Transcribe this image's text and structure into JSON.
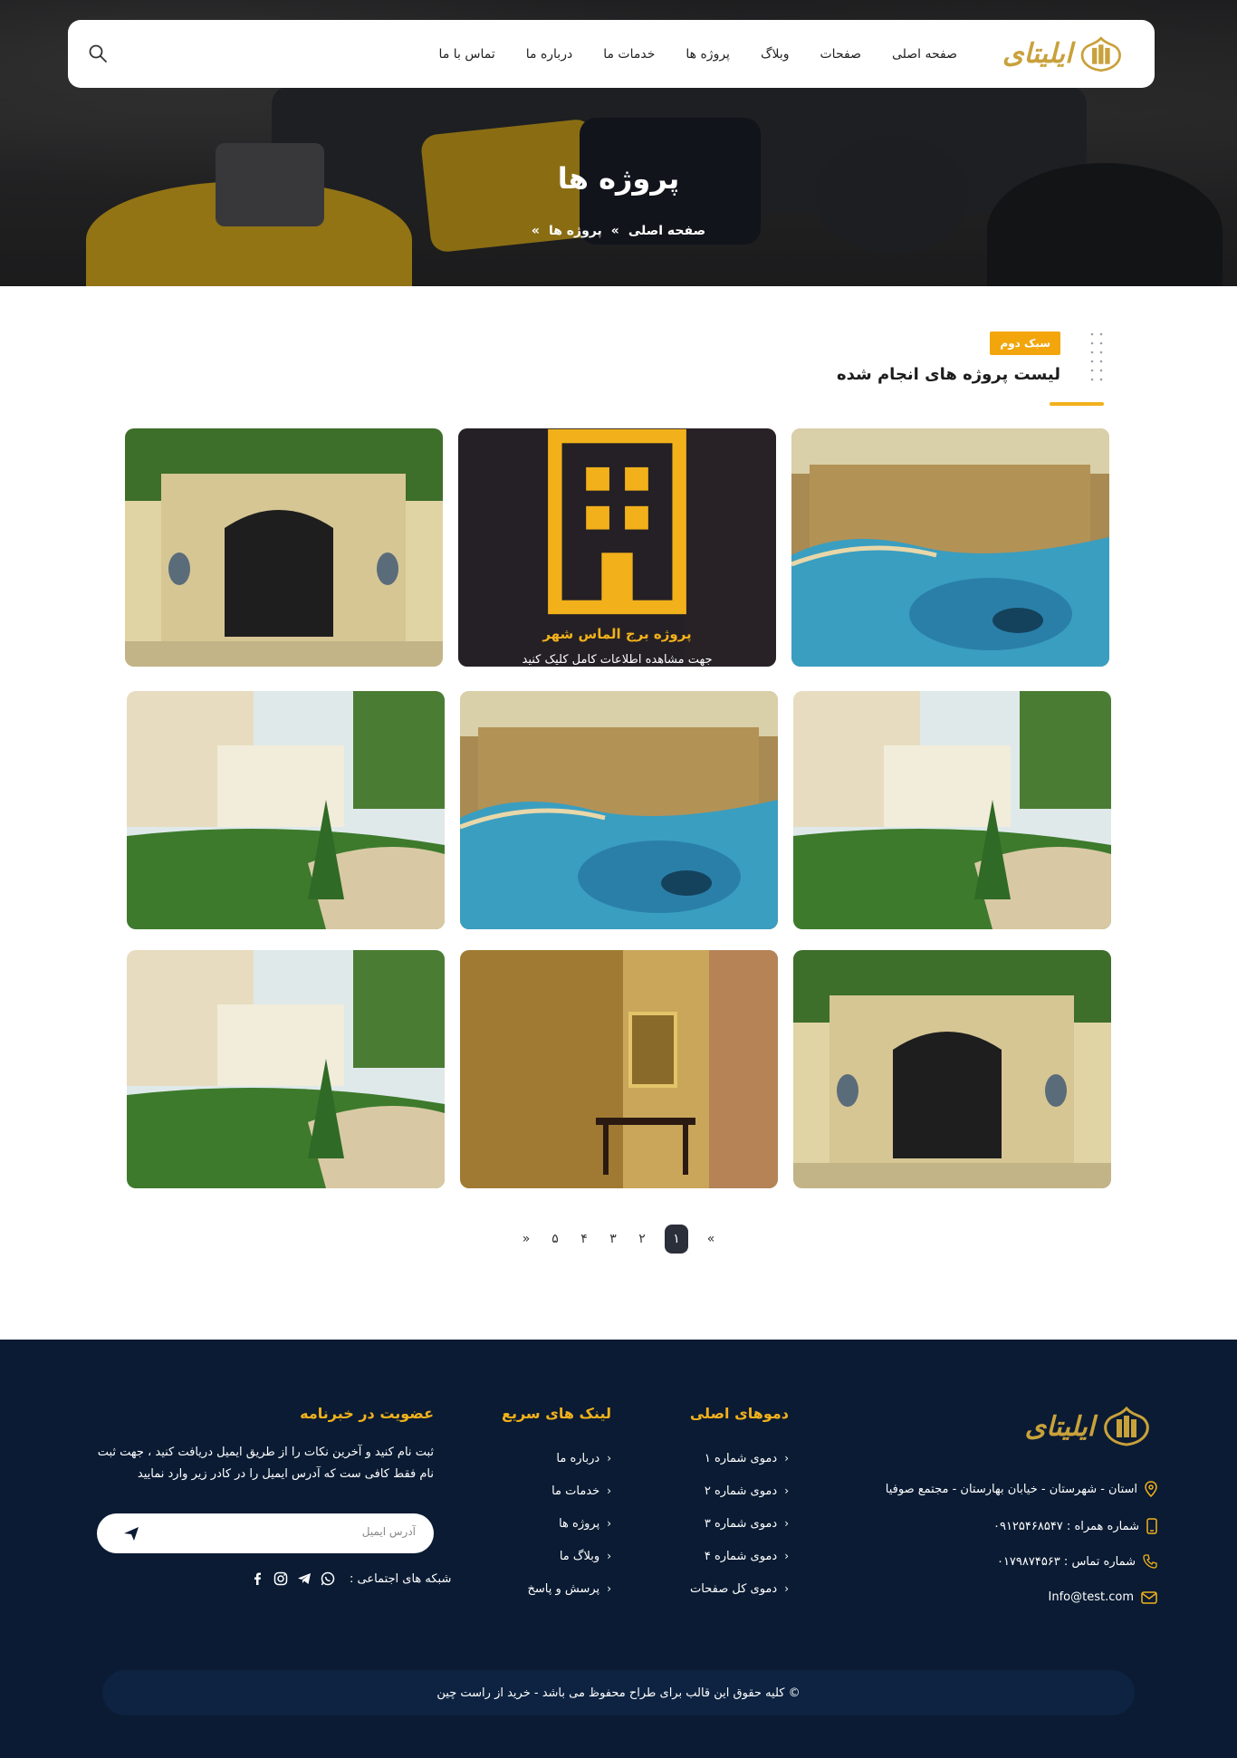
{
  "brand": {
    "logo_text": "ایلیتای",
    "accent": "#f2b11b",
    "footer_bg": "#0a1b33"
  },
  "nav": {
    "items": [
      {
        "label": "صفحه اصلی"
      },
      {
        "label": "صفحات"
      },
      {
        "label": "وبلاگ"
      },
      {
        "label": "پروژه ها"
      },
      {
        "label": "خدمات ما"
      },
      {
        "label": "درباره ما"
      },
      {
        "label": "تماس با ما"
      }
    ],
    "search_icon": "search-icon"
  },
  "hero": {
    "title": "پروژه ها",
    "breadcrumb": [
      "صفحه اصلی",
      "»",
      "پروژه ها",
      "»"
    ]
  },
  "section": {
    "badge": "سبک دوم",
    "title": "لیست پروژه های انجام شده"
  },
  "projects": {
    "hover_card": {
      "icon": "building-icon",
      "title": "پروژه برج الماس شهر",
      "subtitle": "جهت مشاهده اطلاعات کامل کلیک کنید"
    },
    "images": [
      "pool",
      "hover",
      "gate",
      "garden",
      "pool",
      "garden",
      "gate",
      "corridor",
      "garden"
    ]
  },
  "pagination": {
    "items": [
      "«",
      "۱",
      "۲",
      "۳",
      "۴",
      "۵",
      "»"
    ],
    "active": "۱"
  },
  "footer": {
    "logo_text": "ایلیتای",
    "contact": {
      "address": "استان - شهرستان - خیابان بهارستان - مجتمع صوفیا",
      "mobile": "شماره همراه : ۰۹۱۲۵۴۶۸۵۴۷",
      "phone": "شماره تماس : ۰۱۷۹۸۷۴۵۶۳",
      "email": "Info@test.com"
    },
    "demos": {
      "heading": "دموهای اصلی",
      "items": [
        "دموی شماره ۱",
        "دموی شماره ۲",
        "دموی شماره ۳",
        "دموی شماره ۴",
        "دموی کل صفحات"
      ]
    },
    "quick_links": {
      "heading": "لینک های سریع",
      "items": [
        "درباره ما",
        "خدمات ما",
        "پروژه ها",
        "وبلاگ ما",
        "پرسش و پاسخ"
      ]
    },
    "newsletter": {
      "heading": "عضویت در خبرنامه",
      "text": "ثبت نام کنید و آخرین نکات را از طریق ایمیل دریافت کنید ، جهت ثبت نام فقط کافی ست که آدرس ایمیل را در کادر زیر وارد نمایید",
      "placeholder": "آدرس ایمیل",
      "social_label": "شبکه های اجتماعی :",
      "social_icons": [
        "whatsapp-icon",
        "telegram-icon",
        "instagram-icon",
        "facebook-icon"
      ]
    },
    "copyright": "© کلیه حقوق این قالب برای طراح محفوظ می باشد -  خرید از راست چین"
  }
}
